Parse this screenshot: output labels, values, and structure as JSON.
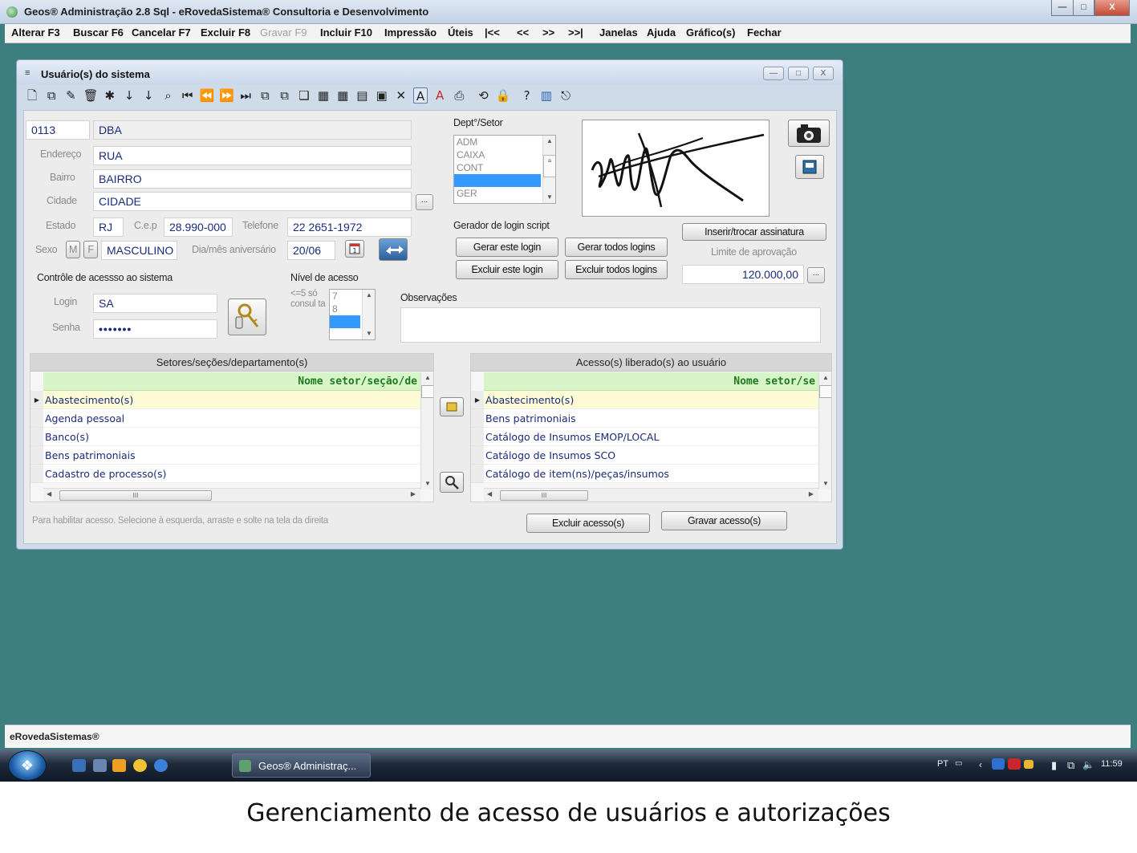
{
  "window": {
    "title": "Geos® Administração 2.8 Sql - eRovedaSistema® Consultoria e Desenvolvimento",
    "min_label": "—",
    "max_label": "□",
    "close_label": "X"
  },
  "menu": {
    "items": [
      {
        "label": "Alterar F3",
        "enabled": true
      },
      {
        "label": "Buscar F6",
        "enabled": true
      },
      {
        "label": "Cancelar F7",
        "enabled": true
      },
      {
        "label": "Excluir F8",
        "enabled": true
      },
      {
        "label": "Gravar F9",
        "enabled": false
      },
      {
        "label": "Incluir F10",
        "enabled": true
      },
      {
        "label": "Impressão",
        "enabled": true
      },
      {
        "label": "Úteis",
        "enabled": true
      },
      {
        "label": "|<<",
        "enabled": true
      },
      {
        "label": "<<",
        "enabled": true
      },
      {
        "label": ">>",
        "enabled": true
      },
      {
        "label": ">>|",
        "enabled": true
      },
      {
        "label": "Janelas",
        "enabled": true
      },
      {
        "label": "Ajuda",
        "enabled": true
      },
      {
        "label": "Gráfico(s)",
        "enabled": true
      },
      {
        "label": "Fechar",
        "enabled": true
      }
    ]
  },
  "child": {
    "title": "Usuário(s) do sistema",
    "icon": "≡"
  },
  "toolbar": {
    "icons": [
      {
        "name": "new-document-icon",
        "glyph": "🗋"
      },
      {
        "name": "copy-record-icon",
        "glyph": "⧉"
      },
      {
        "name": "edit-record-icon",
        "glyph": "✎"
      },
      {
        "name": "delete-record-icon",
        "glyph": "🗑"
      },
      {
        "name": "clear-filter-icon",
        "glyph": "✱"
      },
      {
        "name": "sort-az-icon",
        "glyph": "↓"
      },
      {
        "name": "sort-za-icon",
        "glyph": "↓"
      },
      {
        "name": "search-icon",
        "glyph": "⌕"
      },
      {
        "name": "first-record-icon",
        "glyph": "⏮"
      },
      {
        "name": "previous-record-icon",
        "glyph": "⏪"
      },
      {
        "name": "next-record-icon",
        "glyph": "⏩"
      },
      {
        "name": "last-record-icon",
        "glyph": "⏭"
      },
      {
        "name": "duplicate-icon",
        "glyph": "⧉"
      },
      {
        "name": "paste-icon",
        "glyph": "⧉"
      },
      {
        "name": "window-icon",
        "glyph": "❏"
      },
      {
        "name": "grid-view-icon",
        "glyph": "▦"
      },
      {
        "name": "spreadsheet-icon",
        "glyph": "▦"
      },
      {
        "name": "calculator-icon",
        "glyph": "▤"
      },
      {
        "name": "calendar-icon",
        "glyph": "▣"
      },
      {
        "name": "export-icon",
        "glyph": "✕"
      },
      {
        "name": "font-style-icon",
        "glyph": "A"
      },
      {
        "name": "font-color-icon",
        "glyph": "A"
      },
      {
        "name": "print-icon",
        "glyph": "⎙"
      },
      {
        "name": "refresh-icon",
        "glyph": "⟲"
      },
      {
        "name": "lock-icon",
        "glyph": "🔒"
      },
      {
        "name": "help-icon",
        "glyph": "?"
      },
      {
        "name": "bar-chart-icon",
        "glyph": "▥"
      },
      {
        "name": "exit-icon",
        "glyph": "⎋"
      }
    ]
  },
  "form": {
    "code": "0113",
    "name": "DBA",
    "endereco_label": "Endereço",
    "endereco": "RUA",
    "bairro_label": "Bairro",
    "bairro": "BAIRRO",
    "cidade_label": "Cidade",
    "cidade": "CIDADE",
    "browse_label": "...",
    "estado_label": "Estado",
    "estado": "RJ",
    "cep_label": "C.e.p",
    "cep": "28.990-000",
    "telefone_label": "Telefone",
    "telefone": "22 2651-1972",
    "sexo_label": "Sexo",
    "sexo_m": "M",
    "sexo_f": "F",
    "sexo": "MASCULINO",
    "aniversario_label": "Dia/mês aniversário",
    "aniversario": "20/06",
    "controle_label": "Contrôle de acessso ao sistema",
    "login_label": "Login",
    "login": "SA",
    "senha_label": "Senha",
    "senha": "•••••••",
    "nivel_label": "Nível de acesso",
    "nivel_hint": "<=5  só consul ta",
    "nivel_options": [
      "7",
      "8",
      ""
    ],
    "observacoes_label": "Observações",
    "observacoes": ""
  },
  "dept": {
    "label": "Dept°/Setor",
    "options": [
      "ADM",
      "CAIXA",
      "CONT",
      "",
      "GER"
    ]
  },
  "login_script": {
    "label": "Gerador de login script",
    "gerar_este": "Gerar este login",
    "gerar_todos": "Gerar todos logins",
    "excluir_este": "Excluir este login",
    "excluir_todos": "Excluir todos logins"
  },
  "signature": {
    "inserir_label": "Inserir/trocar assinatura",
    "limite_label": "Limite de aprovação",
    "limite": "120.000,00",
    "browse_label": "..."
  },
  "grid_left": {
    "title": "Setores/seções/departamento(s)",
    "header": "Nome setor/seção/de",
    "rows": [
      "Abastecimento(s)",
      "Agenda pessoal",
      "Banco(s)",
      "Bens patrimoniais",
      "Cadastro de processo(s)"
    ],
    "thumb": "III"
  },
  "grid_right": {
    "title": "Acesso(s) liberado(s) ao usuário",
    "header": "Nome setor/se",
    "rows": [
      "Abastecimento(s)",
      "Bens patrimoniais",
      "Catálogo de Insumos  EMOP/LOCAL",
      "Catálogo de Insumos SCO",
      "Catálogo de item(ns)/peças/insumos"
    ],
    "thumb": "III"
  },
  "bottom": {
    "hint": "Para habilitar acesso. Selecione à esquerda, arraste e solte na tela da direita",
    "excluir_acesso": "Excluir acesso(s)",
    "gravar_acesso": "Gravar acesso(s)"
  },
  "statusbar": {
    "text": "eRovedaSistemas®"
  },
  "taskbar": {
    "task_label": "Geos® Administraç...",
    "lang": "PT",
    "clock": "11:59"
  },
  "caption": "Gerenciamento de acesso de usuários e autorizações"
}
